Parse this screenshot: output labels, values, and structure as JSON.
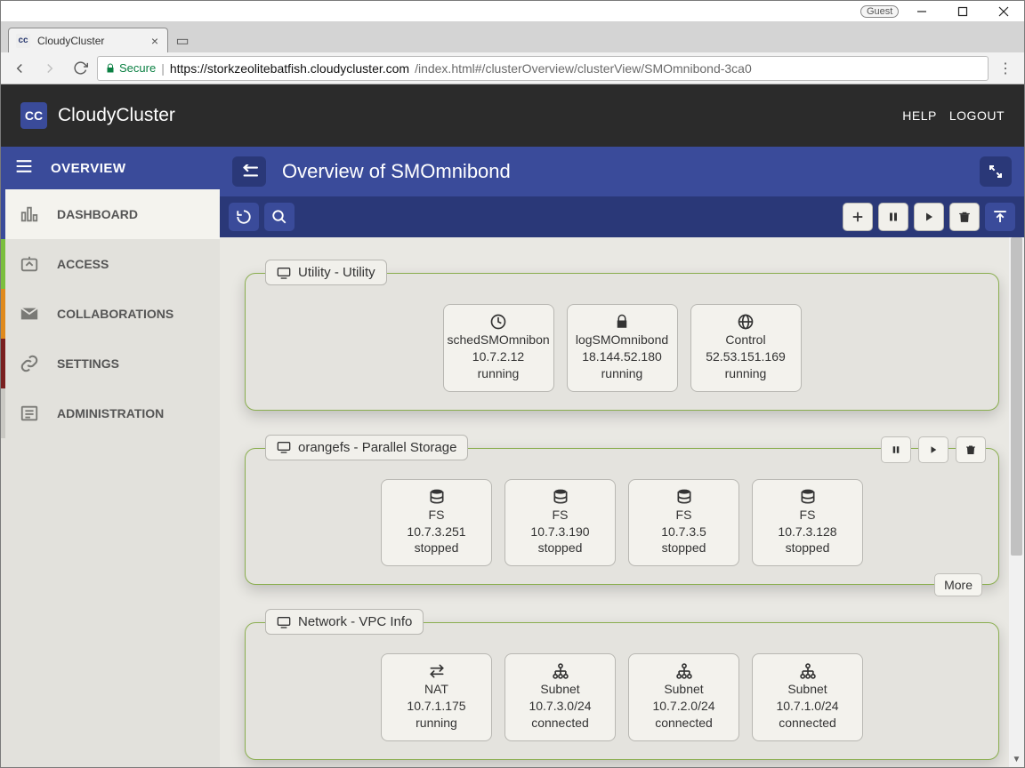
{
  "os": {
    "guest_label": "Guest"
  },
  "browser": {
    "tab_title": "CloudyCluster",
    "secure_label": "Secure",
    "url_domain": "https://storkzeolitebatfish.cloudycluster.com",
    "url_path": "/index.html#/clusterOverview/clusterView/SMOmnibond-3ca0"
  },
  "header": {
    "brand": "CloudyCluster",
    "help": "HELP",
    "logout": "LOGOUT"
  },
  "sidebar": {
    "overview": "OVERVIEW",
    "items": [
      {
        "label": "DASHBOARD"
      },
      {
        "label": "ACCESS"
      },
      {
        "label": "COLLABORATIONS"
      },
      {
        "label": "SETTINGS"
      },
      {
        "label": "ADMINISTRATION"
      }
    ]
  },
  "page": {
    "title": "Overview of SMOmnibond",
    "more_label": "More"
  },
  "groups": [
    {
      "label": "Utility - Utility",
      "actions": [],
      "nodes": [
        {
          "icon": "clock",
          "name": "schedSMOmnibond",
          "ip": "10.7.2.12",
          "state": "running"
        },
        {
          "icon": "lock",
          "name": "logSMOmnibond",
          "ip": "18.144.52.180",
          "state": "running"
        },
        {
          "icon": "globe",
          "name": "Control",
          "ip": "52.53.151.169",
          "state": "running"
        }
      ]
    },
    {
      "label": "orangefs - Parallel Storage",
      "actions": [
        "pause",
        "play",
        "trash"
      ],
      "more": true,
      "nodes": [
        {
          "icon": "db",
          "name": "FS",
          "ip": "10.7.3.251",
          "state": "stopped"
        },
        {
          "icon": "db",
          "name": "FS",
          "ip": "10.7.3.190",
          "state": "stopped"
        },
        {
          "icon": "db",
          "name": "FS",
          "ip": "10.7.3.5",
          "state": "stopped"
        },
        {
          "icon": "db",
          "name": "FS",
          "ip": "10.7.3.128",
          "state": "stopped"
        }
      ]
    },
    {
      "label": "Network - VPC Info",
      "actions": [],
      "nodes": [
        {
          "icon": "nat",
          "name": "NAT",
          "ip": "10.7.1.175",
          "state": "running"
        },
        {
          "icon": "subnet",
          "name": "Subnet",
          "ip": "10.7.3.0/24",
          "state": "connected"
        },
        {
          "icon": "subnet",
          "name": "Subnet",
          "ip": "10.7.2.0/24",
          "state": "connected"
        },
        {
          "icon": "subnet",
          "name": "Subnet",
          "ip": "10.7.1.0/24",
          "state": "connected"
        }
      ]
    }
  ]
}
